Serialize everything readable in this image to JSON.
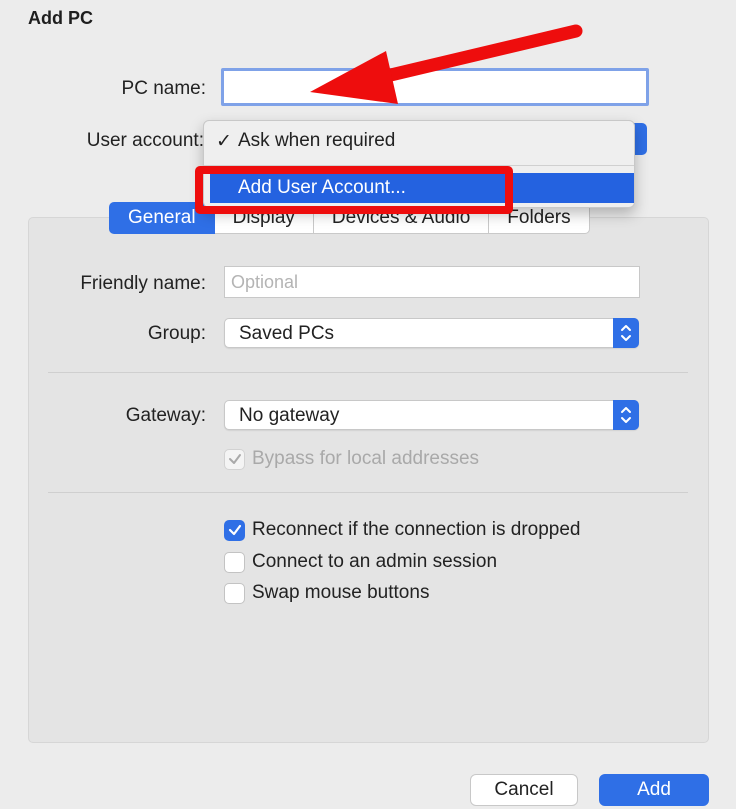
{
  "dialog": {
    "title": "Add PC"
  },
  "pc_name": {
    "label": "PC name:",
    "value": ""
  },
  "user_account": {
    "label": "User account:",
    "menu": {
      "checked_item": "Ask when required",
      "add_item": "Add User Account..."
    }
  },
  "tabs": [
    "General",
    "Display",
    "Devices & Audio",
    "Folders"
  ],
  "general": {
    "friendly_name": {
      "label": "Friendly name:",
      "placeholder": "Optional"
    },
    "group": {
      "label": "Group:",
      "value": "Saved PCs"
    },
    "gateway": {
      "label": "Gateway:",
      "value": "No gateway"
    },
    "bypass": {
      "label": "Bypass for local addresses",
      "checked": true,
      "disabled": true
    },
    "options": [
      {
        "label": "Reconnect if the connection is dropped",
        "checked": true
      },
      {
        "label": "Connect to an admin session",
        "checked": false
      },
      {
        "label": "Swap mouse buttons",
        "checked": false
      }
    ]
  },
  "buttons": {
    "cancel": "Cancel",
    "add": "Add"
  },
  "colors": {
    "accent": "#2f6fe6",
    "annotation": "#ee0d0d"
  }
}
